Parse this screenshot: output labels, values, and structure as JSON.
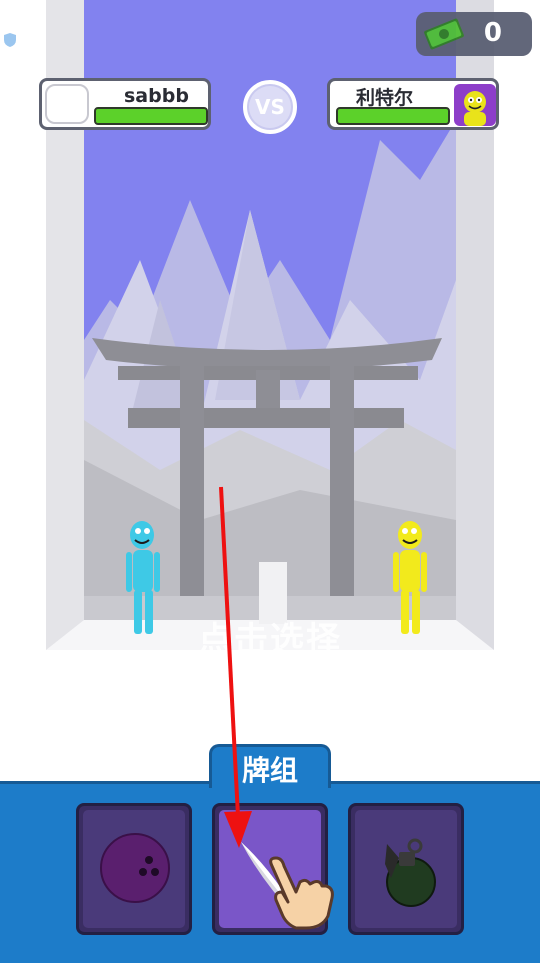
{
  "hud": {
    "money_value": "0",
    "money_icon": "cash-icon",
    "vs_label": "VS"
  },
  "players": {
    "left": {
      "name": "sabbb",
      "health_fraction": 1.0,
      "avatar": "blank-avatar"
    },
    "right": {
      "name": "利特尔",
      "health_fraction": 1.0,
      "avatar": "yellow-smiley-avatar"
    }
  },
  "scene": {
    "hint_text": "点击选择",
    "left_fighter_color": "#3ec9e6",
    "right_fighter_color": "#f2ea1c",
    "sky_color": "#8080f0",
    "gate": "torii-gate"
  },
  "deck": {
    "label": "牌组",
    "cards": [
      {
        "icon": "bowling-ball-icon",
        "selected": false
      },
      {
        "icon": "knife-icon",
        "selected": true
      },
      {
        "icon": "grenade-icon",
        "selected": false
      }
    ]
  },
  "tutorial": {
    "arrow": "red-arrow",
    "hand": "pointing-hand-icon"
  },
  "colors": {
    "deck_panel": "#1d7cc9",
    "card_bg": "#4a3a7a",
    "card_selected_bg": "#7a56c8",
    "health_bar": "#5cd12a"
  }
}
